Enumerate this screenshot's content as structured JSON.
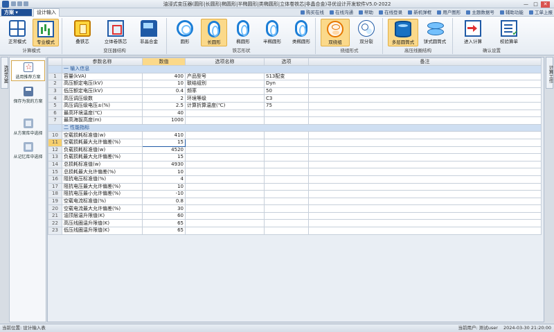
{
  "window": {
    "title": "油浸式变压器(圆形|长圆形|椭圆形|半椭圆形|类椭圆形|立体卷铁芯|非晶合金)寻优设计开发软件V5.0-2022",
    "controls": [
      "—",
      "□",
      "✕"
    ]
  },
  "menu": {
    "label": "方案"
  },
  "tabs": [
    {
      "label": "设计输入"
    }
  ],
  "toplinks": [
    "购买在线",
    "在线沟通",
    "帮助",
    "在线登录",
    "新机弹框",
    "用户图形",
    "主题数据号",
    "辅助功能",
    "工单上报"
  ],
  "ribbon": {
    "groups": [
      {
        "label": "计算模式",
        "buttons": [
          {
            "label": "正常模式",
            "icon": "grid-icon"
          },
          {
            "label": "专业模式",
            "icon": "chart-icon",
            "active": true
          }
        ]
      },
      {
        "label": "变压器结构",
        "buttons": [
          {
            "label": "叠铁芯",
            "icon": "core-icon"
          },
          {
            "label": "立体卷铁芯",
            "icon": "box3d-icon"
          },
          {
            "label": "非晶合金",
            "icon": "amorph-icon"
          }
        ]
      },
      {
        "label": "铁芯形状",
        "buttons": [
          {
            "label": "圆形",
            "icon": "ring-icon"
          },
          {
            "label": "长圆形",
            "icon": "oval-icon",
            "active": true
          },
          {
            "label": "椭圆形",
            "icon": "oval-icon"
          },
          {
            "label": "半椭圆形",
            "icon": "oval-icon"
          },
          {
            "label": "类椭圆形",
            "icon": "oval-icon"
          }
        ]
      },
      {
        "label": "绕组形式",
        "buttons": [
          {
            "label": "双绕组",
            "icon": "winding-icon",
            "active": true
          },
          {
            "label": "双分裂",
            "icon": "split-icon"
          }
        ]
      },
      {
        "label": "高压线圈结构",
        "buttons": [
          {
            "label": "多层圆筒式",
            "icon": "cylinder-icon",
            "active": true
          },
          {
            "label": "饼式圆筒式",
            "icon": "stack-icon"
          }
        ]
      },
      {
        "label": "确认设置",
        "buttons": [
          {
            "label": "进入计算",
            "icon": "enter-icon"
          },
          {
            "label": "校验算单",
            "icon": "checklist-icon"
          }
        ]
      }
    ]
  },
  "side_tabs": {
    "left": "选型方案",
    "right": "计算工作"
  },
  "scheme_panel": {
    "buttons": [
      {
        "label": "选用推荐方案",
        "icon": "star-icon",
        "active": true
      },
      {
        "label": "保存为我的方案",
        "icon": "save-icon"
      },
      {
        "label": "从方案库中选择",
        "icon": "database-icon"
      },
      {
        "label": "从记忆库中选择",
        "icon": "database-icon"
      }
    ]
  },
  "grid": {
    "headers": [
      "参数名称",
      "数值",
      "选项名称",
      "选项",
      "备注"
    ],
    "sections": {
      "input": "一 输入信息",
      "perf": "二 性能指标"
    },
    "rows": [
      {
        "no": "1",
        "name": "容量(kVA)",
        "value": "400",
        "opt_name": "产品型号",
        "opt": "S13配变"
      },
      {
        "no": "2",
        "name": "高压额定电压(kV)",
        "value": "10",
        "opt_name": "联结组别",
        "opt": "Dyn"
      },
      {
        "no": "3",
        "name": "低压额定电压(kV)",
        "value": "0.4",
        "opt_name": "频率",
        "opt": "50"
      },
      {
        "no": "4",
        "name": "高压调压级数",
        "value": "2",
        "opt_name": "环境等级",
        "opt": "C3"
      },
      {
        "no": "5",
        "name": "高压调压级电压±(%)",
        "value": "2.5",
        "opt_name": "计算折算温度(℃)",
        "opt": "75"
      },
      {
        "no": "6",
        "name": "最高环境温度(℃)",
        "value": "40",
        "opt_name": "",
        "opt": ""
      },
      {
        "no": "7",
        "name": "最高海拔高度(m)",
        "value": "1000",
        "opt_name": "",
        "opt": ""
      },
      {
        "no": "10",
        "name": "空载损耗标准值(w)",
        "value": "410",
        "opt_name": "",
        "opt": ""
      },
      {
        "no": "11",
        "name": "空载损耗最大允许偏差(%)",
        "value": "15",
        "opt_name": "",
        "opt": ""
      },
      {
        "no": "12",
        "name": "负载损耗标准值(w)",
        "value": "4520",
        "opt_name": "",
        "opt": ""
      },
      {
        "no": "13",
        "name": "负载损耗最大允许偏差(%)",
        "value": "15",
        "opt_name": "",
        "opt": ""
      },
      {
        "no": "14",
        "name": "总损耗标准值(w)",
        "value": "4930",
        "opt_name": "",
        "opt": ""
      },
      {
        "no": "15",
        "name": "总损耗最大允许偏差(%)",
        "value": "10",
        "opt_name": "",
        "opt": ""
      },
      {
        "no": "16",
        "name": "阻抗电压标准值(%)",
        "value": "4",
        "opt_name": "",
        "opt": ""
      },
      {
        "no": "17",
        "name": "阻抗电压最大允许偏差(%)",
        "value": "10",
        "opt_name": "",
        "opt": ""
      },
      {
        "no": "18",
        "name": "阻抗电压最小允许偏差(%)",
        "value": "-10",
        "opt_name": "",
        "opt": ""
      },
      {
        "no": "19",
        "name": "空载电流标准值(%)",
        "value": "0.8",
        "opt_name": "",
        "opt": ""
      },
      {
        "no": "20",
        "name": "空载电流最大允许偏差(%)",
        "value": "30",
        "opt_name": "",
        "opt": ""
      },
      {
        "no": "21",
        "name": "油顶层温升限值(K)",
        "value": "60",
        "opt_name": "",
        "opt": ""
      },
      {
        "no": "22",
        "name": "高压线圈温升限值(K)",
        "value": "65",
        "opt_name": "",
        "opt": ""
      },
      {
        "no": "23",
        "name": "低压线圈温升限值(K)",
        "value": "65",
        "opt_name": "",
        "opt": ""
      }
    ]
  },
  "status": {
    "left": "当前位置: 设计输入表",
    "user": "当前用户: 测试user",
    "datetime": "2024-03-30 21:20:00"
  }
}
